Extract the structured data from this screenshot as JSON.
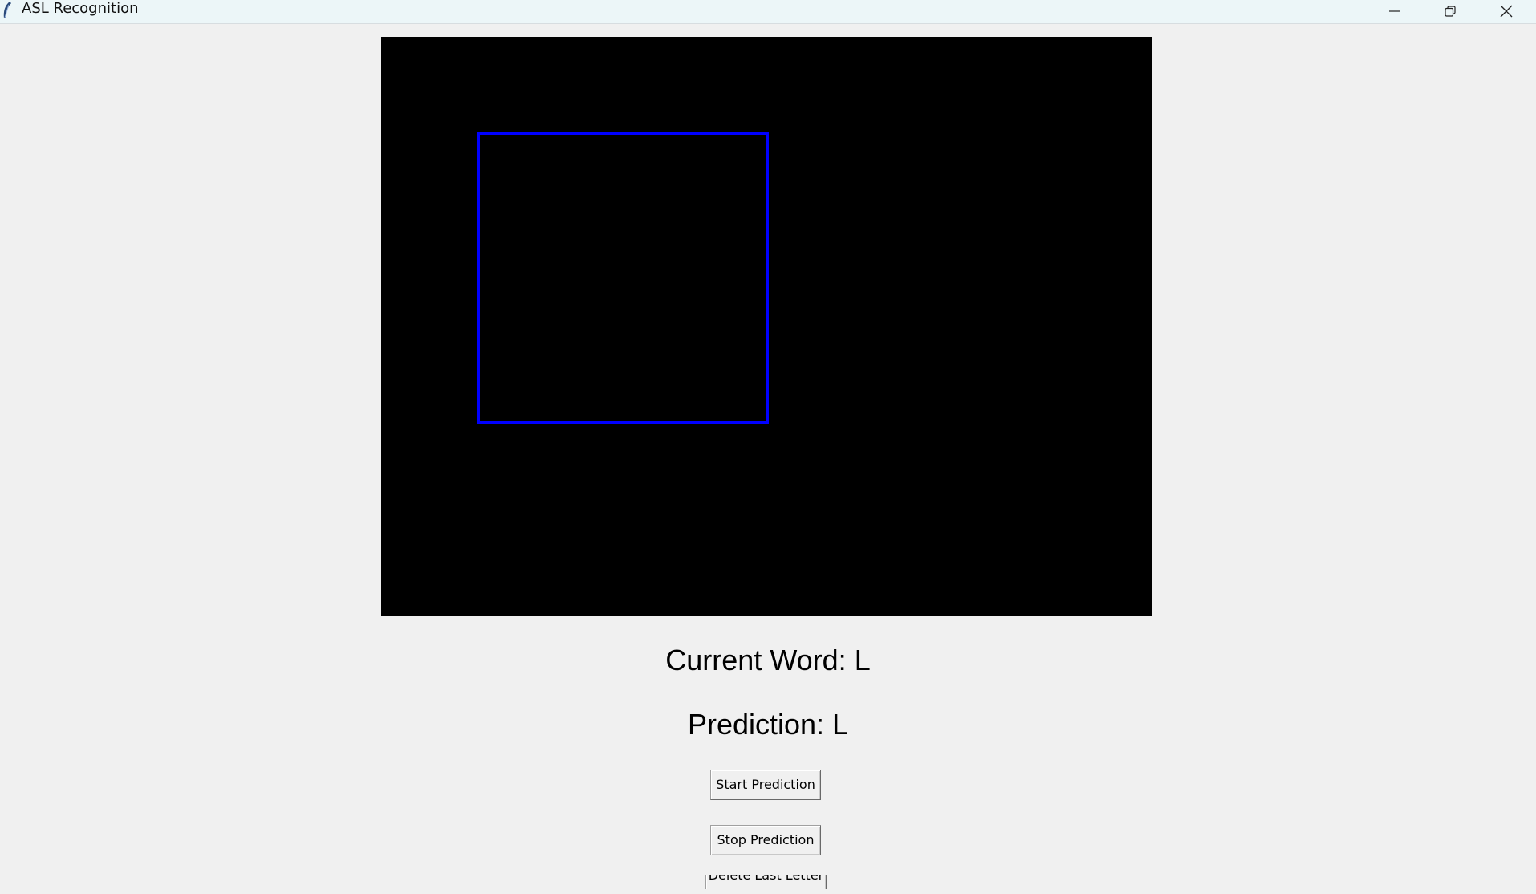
{
  "window": {
    "title": "ASL Recognition",
    "controls": {
      "minimize_icon": "minimize-icon",
      "restore_icon": "restore-icon",
      "close_icon": "close-icon"
    }
  },
  "video": {
    "background_color": "#000000",
    "roi_color": "#0000ff"
  },
  "labels": {
    "current_word": "Current Word: L",
    "prediction": "Prediction: L"
  },
  "buttons": {
    "start": "Start Prediction",
    "stop": "Stop Prediction",
    "delete": "Delete Last Letter"
  }
}
